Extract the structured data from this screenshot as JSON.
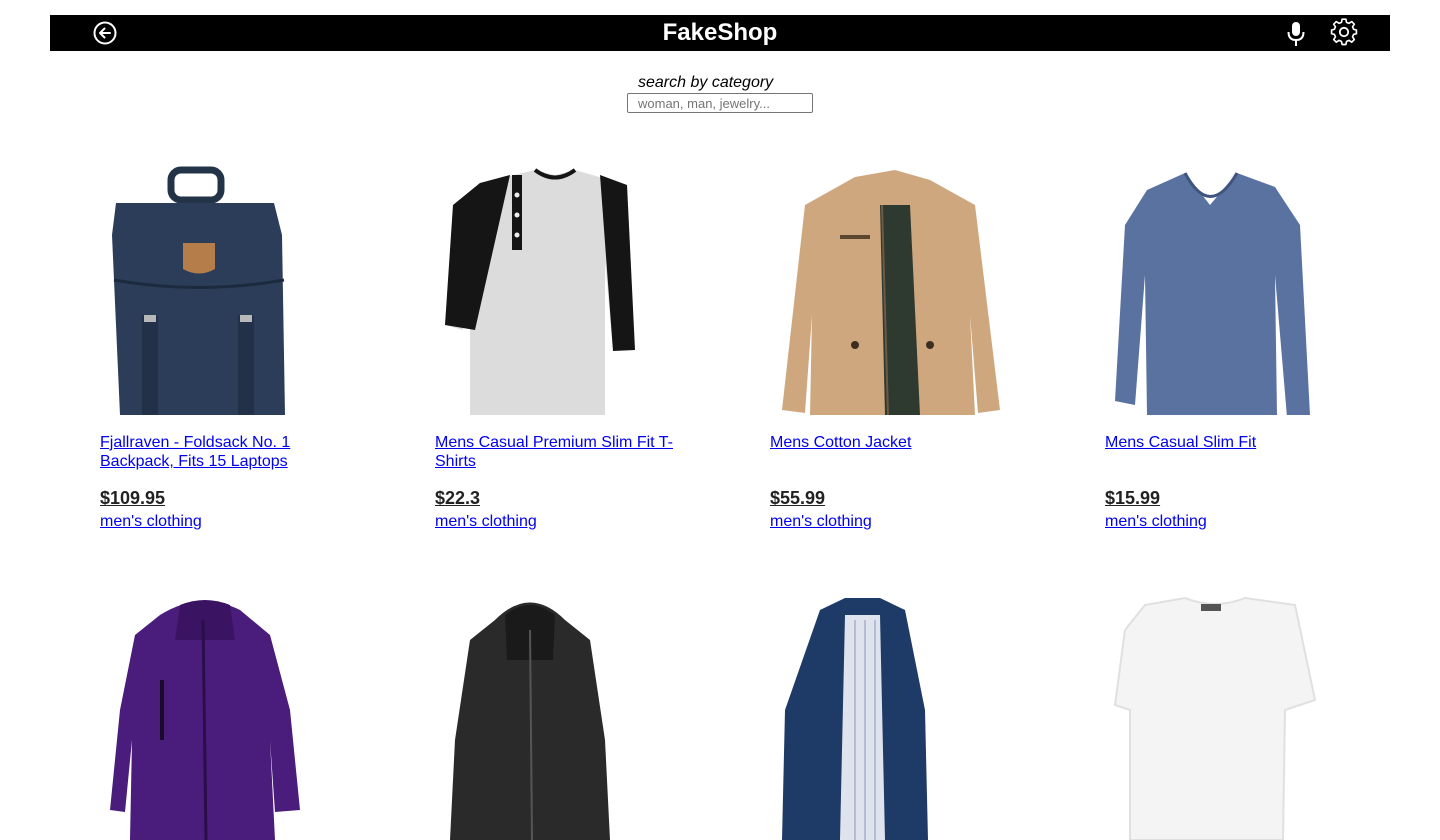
{
  "header": {
    "title": "FakeShop",
    "icons": {
      "back": "back-arrow-circle-icon",
      "mic": "microphone-icon",
      "settings": "gear-icon"
    },
    "background": "#000000"
  },
  "search": {
    "label": "search by category",
    "placeholder": "woman, man, jewelry...",
    "value": ""
  },
  "products": [
    {
      "title": "Fjallraven - Foldsack No. 1 Backpack, Fits 15 Laptops",
      "price": "$109.95",
      "category": "men's clothing"
    },
    {
      "title": "Mens Casual Premium Slim Fit T-Shirts",
      "price": "$22.3",
      "category": "men's clothing"
    },
    {
      "title": "Mens Cotton Jacket",
      "price": "$55.99",
      "category": "men's clothing"
    },
    {
      "title": "Mens Casual Slim Fit",
      "price": "$15.99",
      "category": "men's clothing"
    },
    {
      "title": "",
      "price": "",
      "category": ""
    },
    {
      "title": "",
      "price": "",
      "category": ""
    },
    {
      "title": "",
      "price": "",
      "category": ""
    },
    {
      "title": "",
      "price": "",
      "category": ""
    }
  ],
  "colors": {
    "link": "#0000ee",
    "price": "#222222"
  }
}
